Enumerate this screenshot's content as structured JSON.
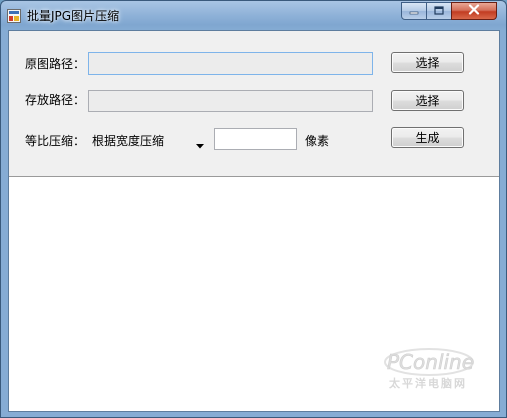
{
  "window": {
    "title": "批量JPG图片压缩",
    "controls": {
      "minimize": "minimize-icon",
      "maximize": "maximize-icon",
      "close": "close-icon"
    }
  },
  "form": {
    "source_path_label": "原图路径：",
    "source_path_value": "",
    "save_path_label": "存放路径：",
    "save_path_value": "",
    "select_button_1": "选择",
    "select_button_2": "选择",
    "scale_label": "等比压缩：",
    "scale_mode_selected": "根据宽度压缩",
    "size_value": "",
    "unit_label": "像素",
    "generate_button": "生成"
  },
  "output": {
    "content": ""
  },
  "watermark": {
    "logo_text": "PConline",
    "sub_text": "太平洋电脑网"
  },
  "colors": {
    "titlebar": "#8fb2d8",
    "client_background": "#f0f0f0",
    "close_button": "#c23d22",
    "focus_border": "#7eb4ea"
  }
}
